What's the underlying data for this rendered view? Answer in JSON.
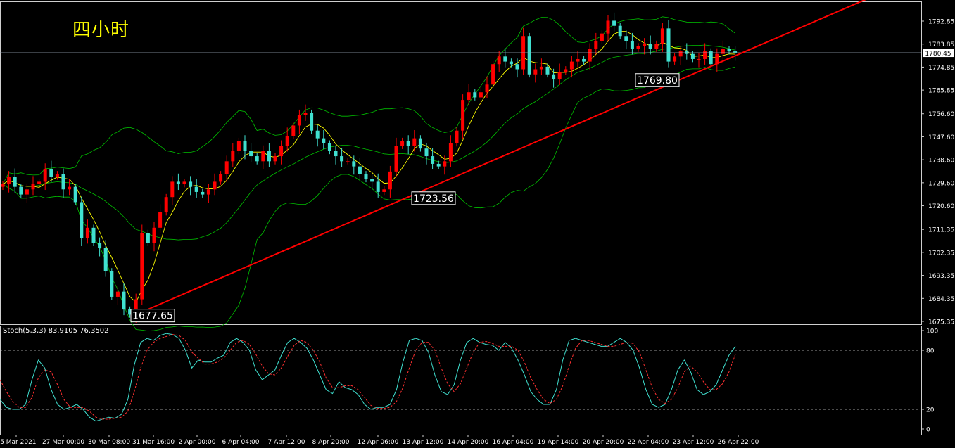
{
  "timeframe_label": "四小时",
  "indicator_label": "Stoch(5,3,3) 83.9105 76.3502",
  "current_price_label": "1780.45",
  "annotations": [
    "1677.65",
    "1723.56",
    "1769.80"
  ],
  "colors": {
    "background": "#000000",
    "bull_candle": "#ff0000",
    "bear_candle": "#40e0d0",
    "bollinger": "#00c000",
    "ma": "#ffff00",
    "trendline": "#ff0000",
    "stoch_main": "#40e0d0",
    "stoch_signal": "#ff3030",
    "axis_text": "#ffffff"
  },
  "chart_data": [
    {
      "type": "candlestick",
      "title": "",
      "ylim": [
        1675.35,
        1792.85
      ],
      "y_ticks": [
        "1792.85",
        "1783.85",
        "1774.85",
        "1765.85",
        "1756.60",
        "1747.60",
        "1738.60",
        "1729.60",
        "1720.60",
        "1711.35",
        "1702.35",
        "1693.35",
        "1684.35",
        "1675.35"
      ],
      "x_ticks": [
        "25 Mar 2021",
        "27 Mar 00:00",
        "30 Mar 08:00",
        "31 Mar 16:00",
        "2 Apr 00:00",
        "6 Apr 04:00",
        "7 Apr 12:00",
        "8 Apr 20:00",
        "12 Apr 06:00",
        "13 Apr 12:00",
        "14 Apr 20:00",
        "16 Apr 04:00",
        "19 Apr 14:00",
        "20 Apr 20:00",
        "22 Apr 04:00",
        "23 Apr 12:00",
        "26 Apr 22:00"
      ],
      "horizontal_line": 1780.45,
      "trendline": {
        "from_price": 1677.65,
        "through_price": 1769.8
      },
      "annotations": [
        {
          "text": "1677.65",
          "price": 1677.65
        },
        {
          "text": "1723.56",
          "price": 1723.56
        },
        {
          "text": "1769.80",
          "price": 1769.8
        }
      ],
      "close": [
        1729,
        1732,
        1728,
        1725,
        1727,
        1729,
        1730,
        1735,
        1732,
        1733,
        1727,
        1728,
        1722,
        1708,
        1712,
        1706,
        1704,
        1695,
        1685,
        1687,
        1680,
        1678,
        1684,
        1710,
        1706,
        1712,
        1718,
        1724,
        1730,
        1729,
        1730,
        1728,
        1726,
        1725,
        1727,
        1730,
        1733,
        1738,
        1742,
        1746,
        1742,
        1740,
        1738,
        1742,
        1738,
        1740,
        1744,
        1748,
        1752,
        1756,
        1757,
        1750,
        1747,
        1745,
        1742,
        1740,
        1738,
        1738,
        1736,
        1733,
        1731,
        1730,
        1726,
        1727,
        1734,
        1744,
        1746,
        1744,
        1747,
        1743,
        1740,
        1737,
        1736,
        1738,
        1745,
        1750,
        1762,
        1765,
        1763,
        1765,
        1768,
        1776,
        1779,
        1777,
        1776,
        1774,
        1787,
        1772,
        1774,
        1775,
        1772,
        1770,
        1773,
        1774,
        1777,
        1778,
        1777,
        1782,
        1785,
        1788,
        1793,
        1791,
        1787,
        1785,
        1782,
        1783,
        1784,
        1782,
        1784,
        1790,
        1777,
        1779,
        1781,
        1780,
        1778,
        1778,
        1781,
        1776,
        1780,
        1782,
        1781,
        1780.5
      ]
    },
    {
      "type": "line",
      "title": "Stoch(5,3,3) 83.9105 76.3502",
      "ylim": [
        0,
        100
      ],
      "y_ticks": [
        "100",
        "80",
        "20",
        "0"
      ],
      "levels": [
        80,
        20
      ],
      "series": [
        {
          "name": "main",
          "values": [
            30,
            22,
            20,
            20,
            25,
            50,
            70,
            62,
            40,
            25,
            20,
            22,
            25,
            20,
            12,
            8,
            10,
            12,
            11,
            15,
            30,
            65,
            88,
            92,
            90,
            95,
            97,
            96,
            92,
            80,
            62,
            70,
            68,
            68,
            72,
            75,
            88,
            92,
            88,
            80,
            60,
            50,
            55,
            60,
            75,
            88,
            92,
            88,
            82,
            70,
            55,
            40,
            36,
            48,
            42,
            40,
            35,
            25,
            20,
            22,
            22,
            25,
            40,
            68,
            90,
            92,
            90,
            78,
            55,
            38,
            35,
            45,
            70,
            88,
            92,
            88,
            86,
            85,
            80,
            88,
            82,
            70,
            55,
            38,
            30,
            25,
            25,
            40,
            70,
            90,
            92,
            90,
            88,
            86,
            84,
            84,
            88,
            92,
            88,
            80,
            62,
            40,
            25,
            22,
            25,
            40,
            60,
            70,
            58,
            40,
            35,
            38,
            45,
            60,
            75,
            84
          ]
        },
        {
          "name": "signal",
          "values": [
            50,
            38,
            28,
            22,
            22,
            32,
            52,
            60,
            58,
            45,
            30,
            22,
            22,
            22,
            18,
            12,
            10,
            10,
            11,
            12,
            18,
            38,
            62,
            80,
            88,
            92,
            94,
            96,
            95,
            90,
            78,
            72,
            66,
            66,
            68,
            72,
            80,
            88,
            90,
            86,
            76,
            64,
            56,
            55,
            62,
            74,
            85,
            90,
            88,
            80,
            68,
            52,
            42,
            42,
            44,
            44,
            40,
            32,
            24,
            21,
            21,
            22,
            28,
            42,
            62,
            80,
            88,
            88,
            80,
            62,
            46,
            38,
            46,
            62,
            78,
            88,
            89,
            87,
            84,
            84,
            84,
            80,
            68,
            52,
            40,
            30,
            26,
            30,
            44,
            64,
            82,
            90,
            90,
            88,
            86,
            84,
            84,
            86,
            88,
            87,
            78,
            60,
            42,
            30,
            26,
            30,
            42,
            58,
            64,
            58,
            48,
            40,
            40,
            46,
            58,
            76
          ]
        }
      ]
    }
  ]
}
